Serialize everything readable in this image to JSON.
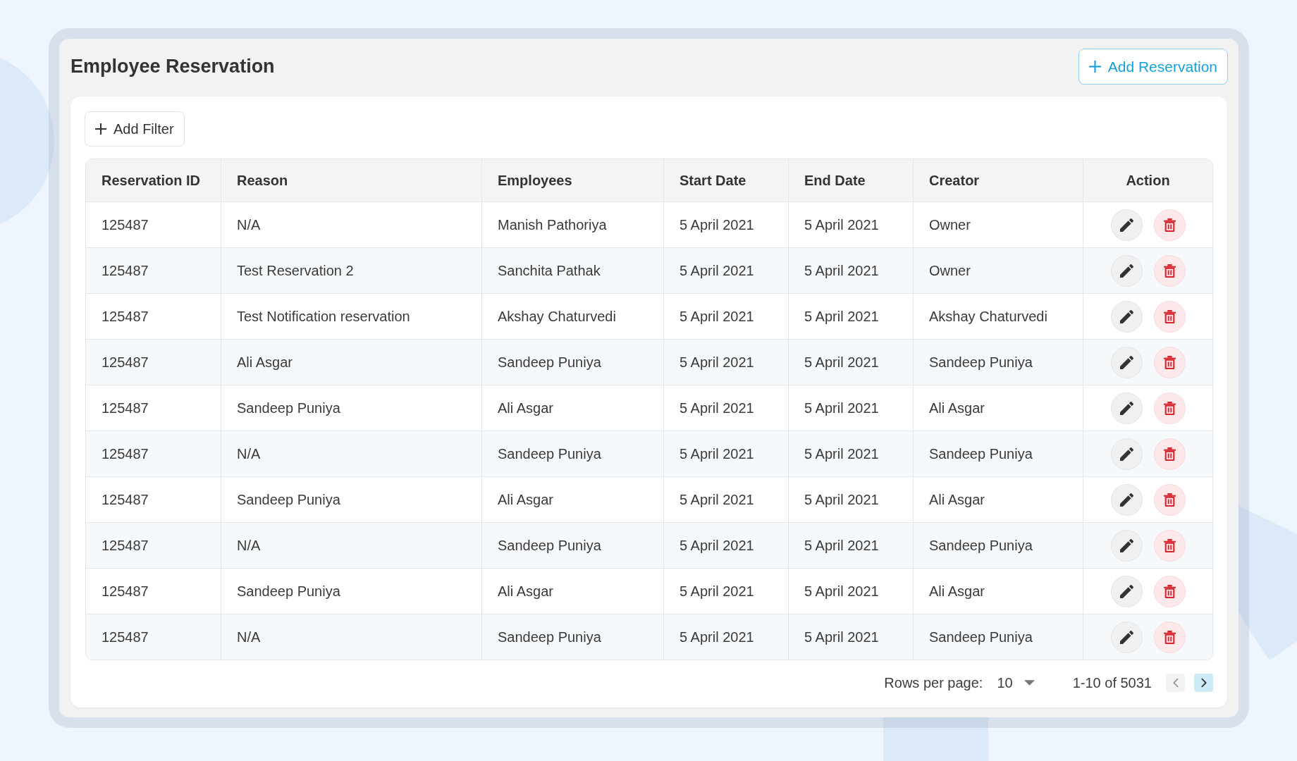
{
  "header": {
    "title": "Employee Reservation",
    "add_button": {
      "label": "Add Reservation"
    }
  },
  "filter_button": {
    "label": "Add Filter"
  },
  "table": {
    "columns": [
      {
        "label": "Reservation ID",
        "kind": "text"
      },
      {
        "label": "Reason",
        "kind": "text"
      },
      {
        "label": "Employees",
        "kind": "text"
      },
      {
        "label": "Start Date",
        "kind": "text"
      },
      {
        "label": "End Date",
        "kind": "text"
      },
      {
        "label": "Creator",
        "kind": "text"
      },
      {
        "label": "Action",
        "kind": "actions"
      }
    ],
    "rows": [
      {
        "cells": [
          "125487",
          "N/A",
          "Manish Pathoriya",
          "5 April 2021",
          "5 April 2021",
          "Owner"
        ]
      },
      {
        "cells": [
          "125487",
          "Test Reservation 2",
          "Sanchita Pathak",
          "5 April 2021",
          "5 April 2021",
          "Owner"
        ]
      },
      {
        "cells": [
          "125487",
          "Test Notification reservation",
          "Akshay Chaturvedi",
          "5 April 2021",
          "5 April 2021",
          "Akshay Chaturvedi"
        ]
      },
      {
        "cells": [
          "125487",
          "Ali Asgar",
          "Sandeep Puniya",
          "5 April 2021",
          "5 April 2021",
          "Sandeep Puniya"
        ]
      },
      {
        "cells": [
          "125487",
          "Sandeep Puniya",
          "Ali Asgar",
          "5 April 2021",
          "5 April 2021",
          "Ali Asgar"
        ]
      },
      {
        "cells": [
          "125487",
          "N/A",
          "Sandeep Puniya",
          "5 April 2021",
          "5 April 2021",
          "Sandeep Puniya"
        ]
      },
      {
        "cells": [
          "125487",
          "Sandeep Puniya",
          "Ali Asgar",
          "5 April 2021",
          "5 April 2021",
          "Ali Asgar"
        ]
      },
      {
        "cells": [
          "125487",
          "N/A",
          "Sandeep Puniya",
          "5 April 2021",
          "5 April 2021",
          "Sandeep Puniya"
        ]
      },
      {
        "cells": [
          "125487",
          "Sandeep Puniya",
          "Ali Asgar",
          "5 April 2021",
          "5 April 2021",
          "Ali Asgar"
        ]
      },
      {
        "cells": [
          "125487",
          "N/A",
          "Sandeep Puniya",
          "5 April 2021",
          "5 April 2021",
          "Sandeep Puniya"
        ]
      }
    ]
  },
  "pagination": {
    "rows_per_page_label": "Rows per page:",
    "rows_per_page_value": "10",
    "range": "1-10 of 5031",
    "previous": {
      "disabled": true
    },
    "next": {
      "disabled": false
    }
  }
}
